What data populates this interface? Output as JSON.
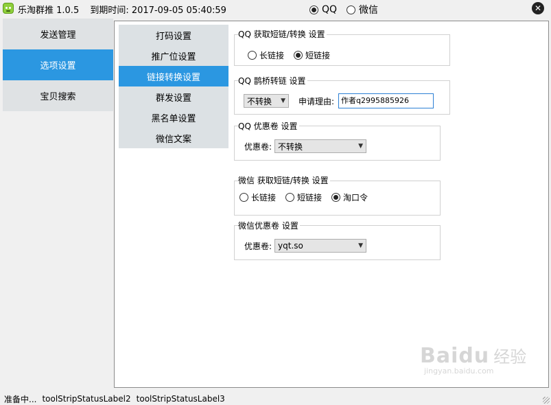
{
  "title": {
    "app_name": "乐淘群推 1.0.5",
    "expiry": "到期时间: 2017-09-05 05:40:59",
    "platform_options": [
      {
        "label": "QQ",
        "selected": true
      },
      {
        "label": "微信",
        "selected": false
      }
    ],
    "close_glyph": "✕"
  },
  "left_nav": {
    "items": [
      {
        "label": "发送管理",
        "active": false
      },
      {
        "label": "选项设置",
        "active": true
      },
      {
        "label": "宝贝搜索",
        "active": false
      }
    ]
  },
  "sub_nav": {
    "items": [
      {
        "label": "打码设置",
        "active": false
      },
      {
        "label": "推广位设置",
        "active": false
      },
      {
        "label": "链接转换设置",
        "active": true
      },
      {
        "label": "群发设置",
        "active": false
      },
      {
        "label": "黑名单设置",
        "active": false
      },
      {
        "label": "微信文案",
        "active": false
      }
    ]
  },
  "qq_short_link": {
    "title": "QQ 获取短链/转换 设置",
    "options": [
      {
        "label": "长链接",
        "selected": false
      },
      {
        "label": "短链接",
        "selected": true
      }
    ]
  },
  "qq_bridge": {
    "title": "QQ 鹊桥转链 设置",
    "select_value": "不转换",
    "reason_label": "申请理由:",
    "reason_value": "作者q2995885926"
  },
  "qq_coupon": {
    "title": "QQ 优惠卷 设置",
    "label": "优惠卷:",
    "select_value": "不转换"
  },
  "wx_short_link": {
    "title": "微信 获取短链/转换 设置",
    "options": [
      {
        "label": "长链接",
        "selected": false
      },
      {
        "label": "短链接",
        "selected": false
      },
      {
        "label": "淘口令",
        "selected": true
      }
    ]
  },
  "wx_coupon": {
    "title": "微信优惠卷 设置",
    "label": "优惠卷:",
    "select_value": "yqt.so"
  },
  "statusbar": {
    "items": [
      "准备中...",
      "toolStripStatusLabel2",
      "toolStripStatusLabel3"
    ]
  },
  "watermark": {
    "brand": "Baidu",
    "cn": "经验",
    "url": "jingyan.baidu.com"
  },
  "colors": {
    "accent": "#2b97e1",
    "nav_bg": "#dfe2e4"
  }
}
